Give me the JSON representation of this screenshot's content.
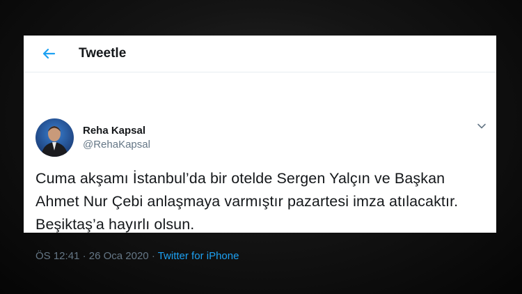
{
  "header": {
    "title": "Tweetle"
  },
  "tweet": {
    "author_name": "Reha Kapsal",
    "author_handle": "@RehaKapsal",
    "text": "Cuma akşamı İstanbul’da bir otelde Sergen Yalçın ve Başkan Ahmet Nur Çebi anlaşmaya varmıştır pazartesi imza atılacaktır. Beşiktaş’a hayırlı olsun.",
    "time": "ÖS 12:41",
    "separator": "·",
    "date": "26 Oca 2020",
    "source": "Twitter for iPhone"
  },
  "icons": {
    "back": "back-arrow-icon",
    "caret": "chevron-down-icon"
  },
  "colors": {
    "accent": "#1da1f2",
    "secondary_text": "#657786",
    "primary_text": "#14171a"
  }
}
